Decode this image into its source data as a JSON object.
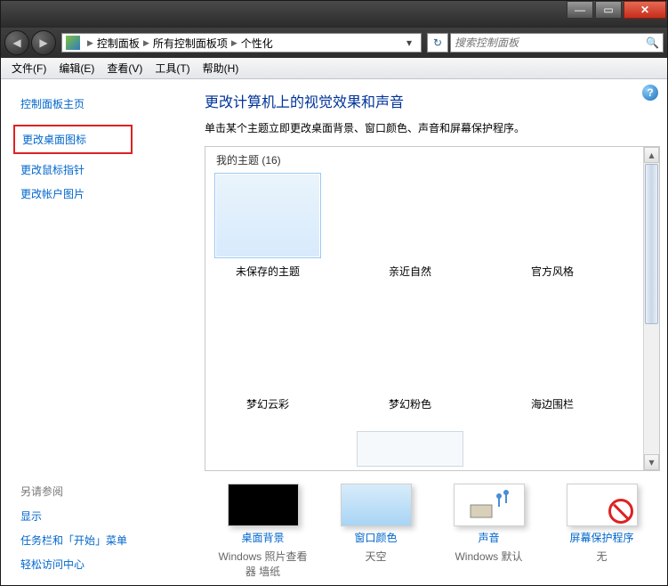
{
  "titlebar": {
    "min": "—",
    "max": "▭",
    "close": "✕"
  },
  "nav": {
    "back": "◀",
    "fwd": "▶",
    "refresh": "↻",
    "drop": "▾"
  },
  "breadcrumb": {
    "a": "控制面板",
    "b": "所有控制面板项",
    "c": "个性化"
  },
  "search": {
    "placeholder": "搜索控制面板",
    "icon": "🔍"
  },
  "menu": {
    "file": "文件(F)",
    "edit": "编辑(E)",
    "view": "查看(V)",
    "tools": "工具(T)",
    "help": "帮助(H)"
  },
  "sidebar": {
    "home": "控制面板主页",
    "desktop_icons": "更改桌面图标",
    "mouse_pointers": "更改鼠标指针",
    "account_pic": "更改帐户图片",
    "see_also": "另请参阅",
    "display": "显示",
    "taskbar": "任务栏和「开始」菜单",
    "ease": "轻松访问中心"
  },
  "main": {
    "heading": "更改计算机上的视觉效果和声音",
    "sub": "单击某个主题立即更改桌面背景、窗口颜色、声音和屏幕保护程序。",
    "my_themes_label": "我的主题 (16)",
    "help": "?"
  },
  "themes": {
    "t1": "未保存的主题",
    "t2": "亲近自然",
    "t3": "官方风格",
    "t4": "梦幻云彩",
    "t5": "梦幻粉色",
    "t6": "海边围栏"
  },
  "bottom": {
    "bg_title": "桌面背景",
    "bg_sub": "Windows 照片查看器 墙纸",
    "color_title": "窗口颜色",
    "color_sub": "天空",
    "sound_title": "声音",
    "sound_sub": "Windows 默认",
    "ssr_title": "屏幕保护程序",
    "ssr_sub": "无"
  },
  "scroll": {
    "up": "▴",
    "down": "▾"
  }
}
